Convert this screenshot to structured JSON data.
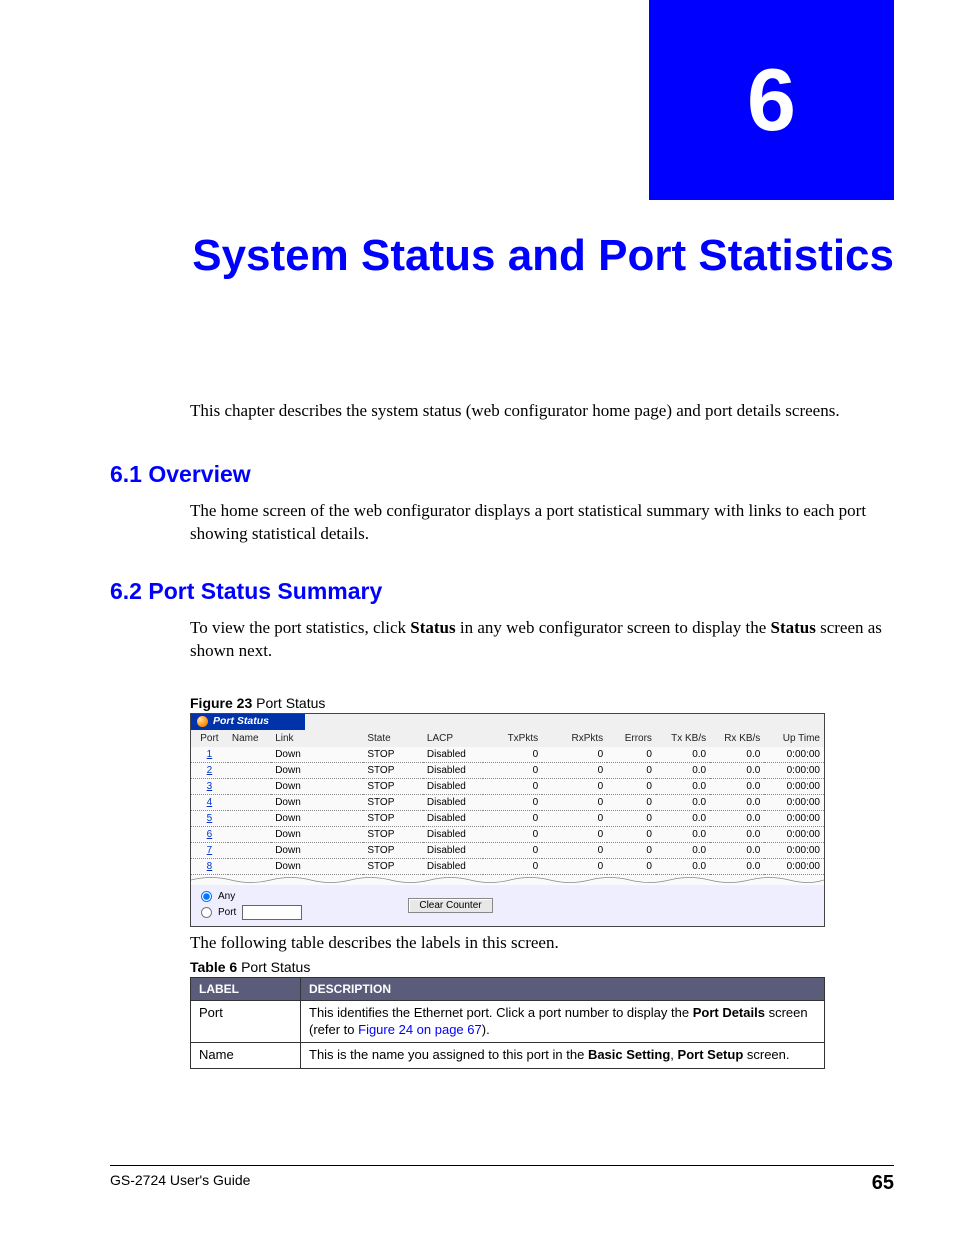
{
  "chapter": {
    "number": "6",
    "title": "System Status and Port Statistics"
  },
  "intro": "This chapter describes the system status (web configurator home page) and port details screens.",
  "sections": {
    "overview": {
      "heading": "6.1  Overview",
      "body": "The home screen of the web configurator displays a port statistical summary with links to each port showing statistical details."
    },
    "port_status": {
      "heading": "6.2  Port Status Summary",
      "body_pre": "To view the port statistics, click ",
      "body_bold1": "Status",
      "body_mid": " in any web configurator screen to display the ",
      "body_bold2": "Status",
      "body_post": " screen as shown next."
    }
  },
  "figure": {
    "caption_bold": "Figure 23",
    "caption_rest": "   Port Status",
    "title_bar": "Port Status",
    "headers": [
      "Port",
      "Name",
      "Link",
      "State",
      "LACP",
      "TxPkts",
      "RxPkts",
      "Errors",
      "Tx KB/s",
      "Rx KB/s",
      "Up Time"
    ],
    "rows": [
      {
        "port": "1",
        "name": "",
        "link": "Down",
        "state": "STOP",
        "lacp": "Disabled",
        "tx": "0",
        "rx": "0",
        "err": "0",
        "txkb": "0.0",
        "rxkb": "0.0",
        "up": "0:00:00"
      },
      {
        "port": "2",
        "name": "",
        "link": "Down",
        "state": "STOP",
        "lacp": "Disabled",
        "tx": "0",
        "rx": "0",
        "err": "0",
        "txkb": "0.0",
        "rxkb": "0.0",
        "up": "0:00:00"
      },
      {
        "port": "3",
        "name": "",
        "link": "Down",
        "state": "STOP",
        "lacp": "Disabled",
        "tx": "0",
        "rx": "0",
        "err": "0",
        "txkb": "0.0",
        "rxkb": "0.0",
        "up": "0:00:00"
      },
      {
        "port": "4",
        "name": "",
        "link": "Down",
        "state": "STOP",
        "lacp": "Disabled",
        "tx": "0",
        "rx": "0",
        "err": "0",
        "txkb": "0.0",
        "rxkb": "0.0",
        "up": "0:00:00"
      },
      {
        "port": "5",
        "name": "",
        "link": "Down",
        "state": "STOP",
        "lacp": "Disabled",
        "tx": "0",
        "rx": "0",
        "err": "0",
        "txkb": "0.0",
        "rxkb": "0.0",
        "up": "0:00:00"
      },
      {
        "port": "6",
        "name": "",
        "link": "Down",
        "state": "STOP",
        "lacp": "Disabled",
        "tx": "0",
        "rx": "0",
        "err": "0",
        "txkb": "0.0",
        "rxkb": "0.0",
        "up": "0:00:00"
      },
      {
        "port": "7",
        "name": "",
        "link": "Down",
        "state": "STOP",
        "lacp": "Disabled",
        "tx": "0",
        "rx": "0",
        "err": "0",
        "txkb": "0.0",
        "rxkb": "0.0",
        "up": "0:00:00"
      },
      {
        "port": "8",
        "name": "",
        "link": "Down",
        "state": "STOP",
        "lacp": "Disabled",
        "tx": "0",
        "rx": "0",
        "err": "0",
        "txkb": "0.0",
        "rxkb": "0.0",
        "up": "0:00:00"
      }
    ],
    "controls": {
      "radio_any": "Any",
      "radio_port": "Port",
      "button": "Clear Counter"
    }
  },
  "post_figure_text": "The following table describes the labels in this screen.",
  "table6": {
    "caption_bold": "Table 6",
    "caption_rest": "   Port Status",
    "headers": {
      "label": "LABEL",
      "desc": "DESCRIPTION"
    },
    "rows": [
      {
        "label": "Port",
        "desc_pre": "This identifies the Ethernet port. Click a port number to display the ",
        "bold1": "Port Details",
        "desc_mid": " screen (refer to ",
        "link": "Figure 24 on page 67",
        "desc_post": ")."
      },
      {
        "label": "Name",
        "desc_pre": "This is the name you assigned to this port in the ",
        "bold1": "Basic Setting",
        "desc_mid": ", ",
        "bold2": "Port Setup",
        "desc_post": " screen."
      }
    ]
  },
  "footer": {
    "guide": "GS-2724 User's Guide",
    "page": "65"
  }
}
